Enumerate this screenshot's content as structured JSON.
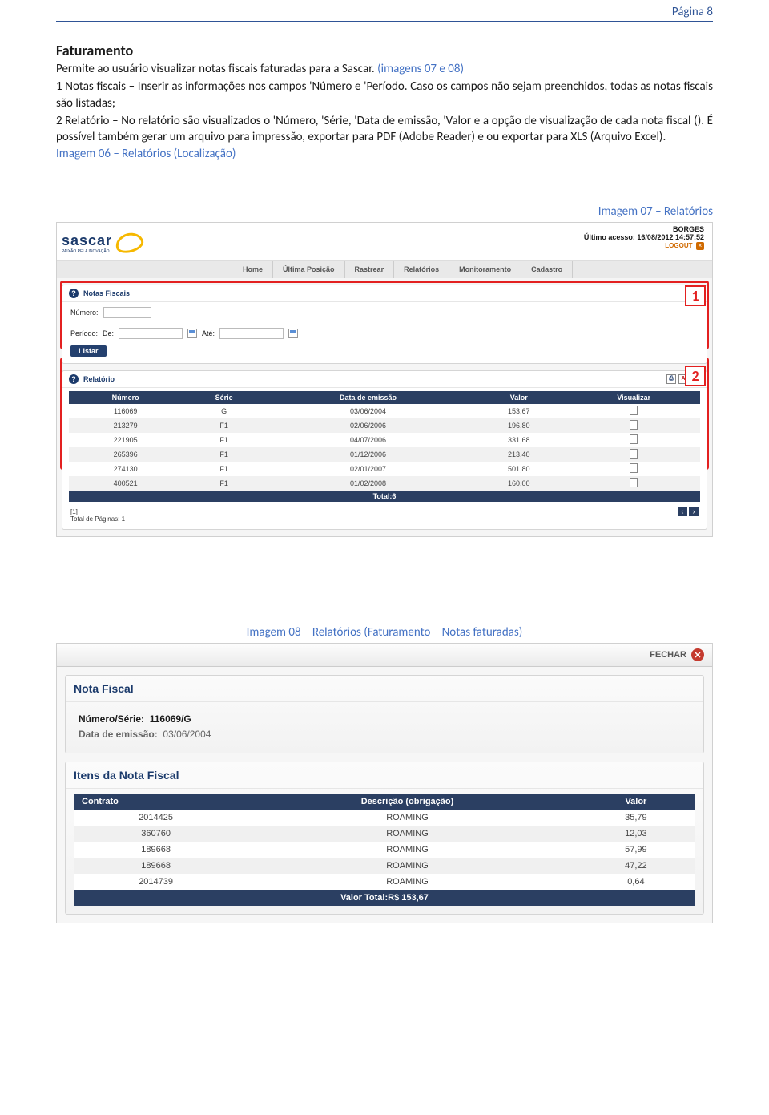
{
  "page_header": "Página 8",
  "section_title": "Faturamento",
  "paragraph": {
    "line1": "Permite ao usuário visualizar notas fiscais faturadas para a Sascar. ",
    "imgs_ref": "(imagens 07 e 08)",
    "pt1": "1 Notas fiscais – Inserir as informações nos campos 'Número e 'Período. Caso os campos não sejam preenchidos, todas as notas fiscais são listadas;",
    "pt2": "2 Relatório – No relatório são visualizados o 'Número, 'Série, 'Data de emissão, 'Valor e a opção de visualização de cada nota fiscal (). É possível também gerar um arquivo para impressão, exportar para PDF (Adobe Reader) e ou exportar para XLS (Arquivo Excel).",
    "caption06": "Imagem 06 – Relatórios (Localização)"
  },
  "caption07": "Imagem 07 – Relatórios",
  "caption08": "Imagem 08 – Relatórios (Faturamento – Notas faturadas)",
  "callouts": {
    "c1": "1",
    "c2": "2"
  },
  "shot1": {
    "brand": "sascar",
    "brand_sub": "PAIXÃO PELA INOVAÇÃO",
    "user": "BORGES",
    "last_access_label": "Último acesso:",
    "last_access_value": "16/08/2012 14:57:52",
    "logout": "LOGOUT",
    "nav": [
      "Home",
      "Última Posição",
      "Rastrear",
      "Relatórios",
      "Monitoramento",
      "Cadastro"
    ],
    "panel1_title": "Notas Fiscais",
    "lbl_numero": "Número:",
    "lbl_periodo": "Período:",
    "lbl_de": "De:",
    "lbl_ate": "Até:",
    "btn_listar": "Listar",
    "panel2_title": "Relatório",
    "columns": [
      "Número",
      "Série",
      "Data de emissão",
      "Valor",
      "Visualizar"
    ],
    "rows": [
      {
        "num": "116069",
        "serie": "G",
        "data": "03/06/2004",
        "valor": "153,67"
      },
      {
        "num": "213279",
        "serie": "F1",
        "data": "02/06/2006",
        "valor": "196,80"
      },
      {
        "num": "221905",
        "serie": "F1",
        "data": "04/07/2006",
        "valor": "331,68"
      },
      {
        "num": "265396",
        "serie": "F1",
        "data": "01/12/2006",
        "valor": "213,40"
      },
      {
        "num": "274130",
        "serie": "F1",
        "data": "02/01/2007",
        "valor": "501,80"
      },
      {
        "num": "400521",
        "serie": "F1",
        "data": "01/02/2008",
        "valor": "160,00"
      }
    ],
    "total_label": "Total:6",
    "page_link": "[1]",
    "pager_label": "Total de Páginas: 1"
  },
  "shot2": {
    "close": "FECHAR",
    "panel1_title": "Nota Fiscal",
    "numserie_label": "Número/Série:",
    "numserie_value": "116069/G",
    "emissao_label": "Data de emissão:",
    "emissao_value": "03/06/2004",
    "panel2_title": "Itens da Nota Fiscal",
    "columns": [
      "Contrato",
      "Descrição (obrigação)",
      "Valor"
    ],
    "rows": [
      {
        "contrato": "2014425",
        "desc": "ROAMING",
        "valor": "35,79"
      },
      {
        "contrato": "360760",
        "desc": "ROAMING",
        "valor": "12,03"
      },
      {
        "contrato": "189668",
        "desc": "ROAMING",
        "valor": "57,99"
      },
      {
        "contrato": "189668",
        "desc": "ROAMING",
        "valor": "47,22"
      },
      {
        "contrato": "2014739",
        "desc": "ROAMING",
        "valor": "0,64"
      }
    ],
    "total_label": "Valor Total:R$ 153,67"
  }
}
